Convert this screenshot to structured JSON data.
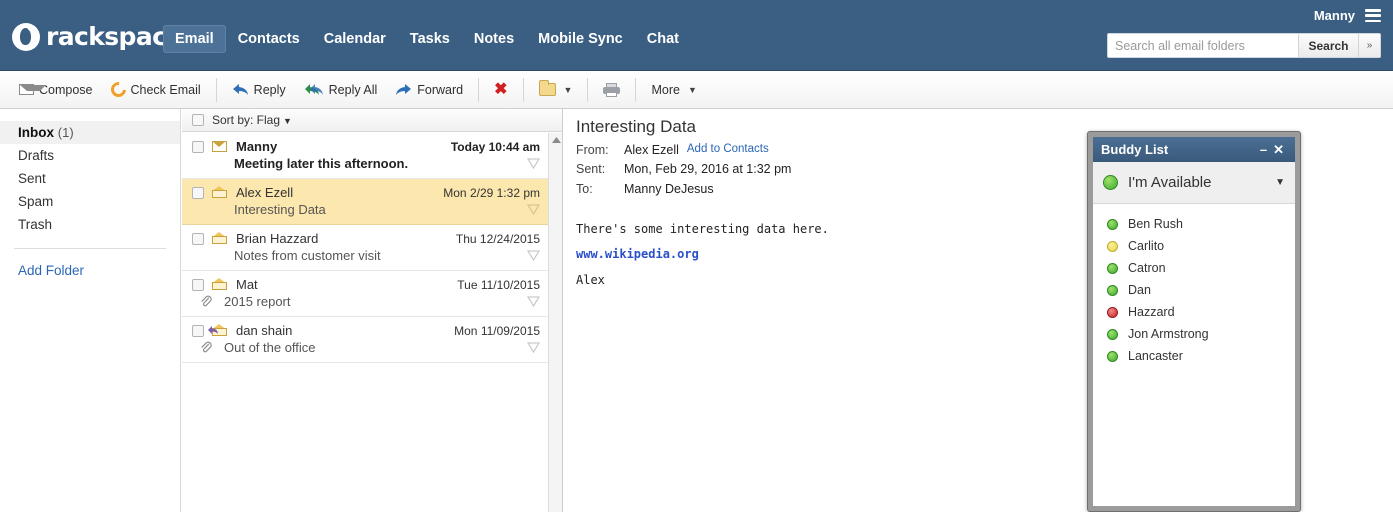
{
  "header": {
    "brand": "rackspace.",
    "nav": [
      {
        "label": "Email",
        "active": true
      },
      {
        "label": "Contacts",
        "active": false
      },
      {
        "label": "Calendar",
        "active": false
      },
      {
        "label": "Tasks",
        "active": false
      },
      {
        "label": "Notes",
        "active": false
      },
      {
        "label": "Mobile Sync",
        "active": false
      },
      {
        "label": "Chat",
        "active": false
      }
    ],
    "user": "Manny",
    "search": {
      "placeholder": "Search all email folders",
      "value": "",
      "button": "Search",
      "more": "»"
    },
    "bg_color": "#3b5f83"
  },
  "toolbar": {
    "compose": "Compose",
    "check_email": "Check Email",
    "reply": "Reply",
    "reply_all": "Reply All",
    "forward": "Forward",
    "more": "More"
  },
  "sidebar": {
    "folders": [
      {
        "label": "Inbox",
        "count": "(1)",
        "active": true
      },
      {
        "label": "Drafts",
        "count": "",
        "active": false
      },
      {
        "label": "Sent",
        "count": "",
        "active": false
      },
      {
        "label": "Spam",
        "count": "",
        "active": false
      },
      {
        "label": "Trash",
        "count": "",
        "active": false
      }
    ],
    "add_folder": "Add Folder"
  },
  "message_list": {
    "sort_by": "Sort by: Flag",
    "messages": [
      {
        "from": "Manny",
        "subject": "Meeting later this afternoon.",
        "date": "Today 10:44 am",
        "unread": true,
        "selected": false,
        "icon": "envelope-closed-blue",
        "attachment": false
      },
      {
        "from": "Alex Ezell",
        "subject": "Interesting Data",
        "date": "Mon 2/29 1:32 pm",
        "unread": false,
        "selected": true,
        "icon": "envelope-open",
        "attachment": false
      },
      {
        "from": "Brian Hazzard",
        "subject": "Notes from customer visit",
        "date": "Thu 12/24/2015",
        "unread": false,
        "selected": false,
        "icon": "envelope-open",
        "attachment": false
      },
      {
        "from": "Mat",
        "subject": "2015 report",
        "date": "Tue 11/10/2015",
        "unread": false,
        "selected": false,
        "icon": "envelope-open",
        "attachment": true
      },
      {
        "from": "dan shain",
        "subject": "Out of the office",
        "date": "Mon 11/09/2015",
        "unread": false,
        "selected": false,
        "icon": "envelope-replied",
        "attachment": true
      }
    ],
    "selected_highlight": "#fce8ae"
  },
  "reading_pane": {
    "subject": "Interesting Data",
    "from_label": "From:",
    "from_value": "Alex Ezell",
    "add_to_contacts": "Add to Contacts",
    "sent_label": "Sent:",
    "sent_value": "Mon, Feb 29, 2016 at 1:32 pm",
    "to_label": "To:",
    "to_value": "Manny DeJesus",
    "body_line1": "There's some interesting data here.",
    "body_link": "www.wikipedia.org",
    "body_signature": "Alex"
  },
  "buddy_list": {
    "title": "Buddy List",
    "minimize": "–",
    "close": "✕",
    "status": "I'm Available",
    "status_color": "green",
    "buddies": [
      {
        "name": "Ben Rush",
        "status": "green"
      },
      {
        "name": "Carlito",
        "status": "yellow"
      },
      {
        "name": "Catron",
        "status": "green"
      },
      {
        "name": "Dan",
        "status": "green"
      },
      {
        "name": "Hazzard",
        "status": "red"
      },
      {
        "name": "Jon Armstrong",
        "status": "green"
      },
      {
        "name": "Lancaster",
        "status": "green"
      }
    ]
  }
}
